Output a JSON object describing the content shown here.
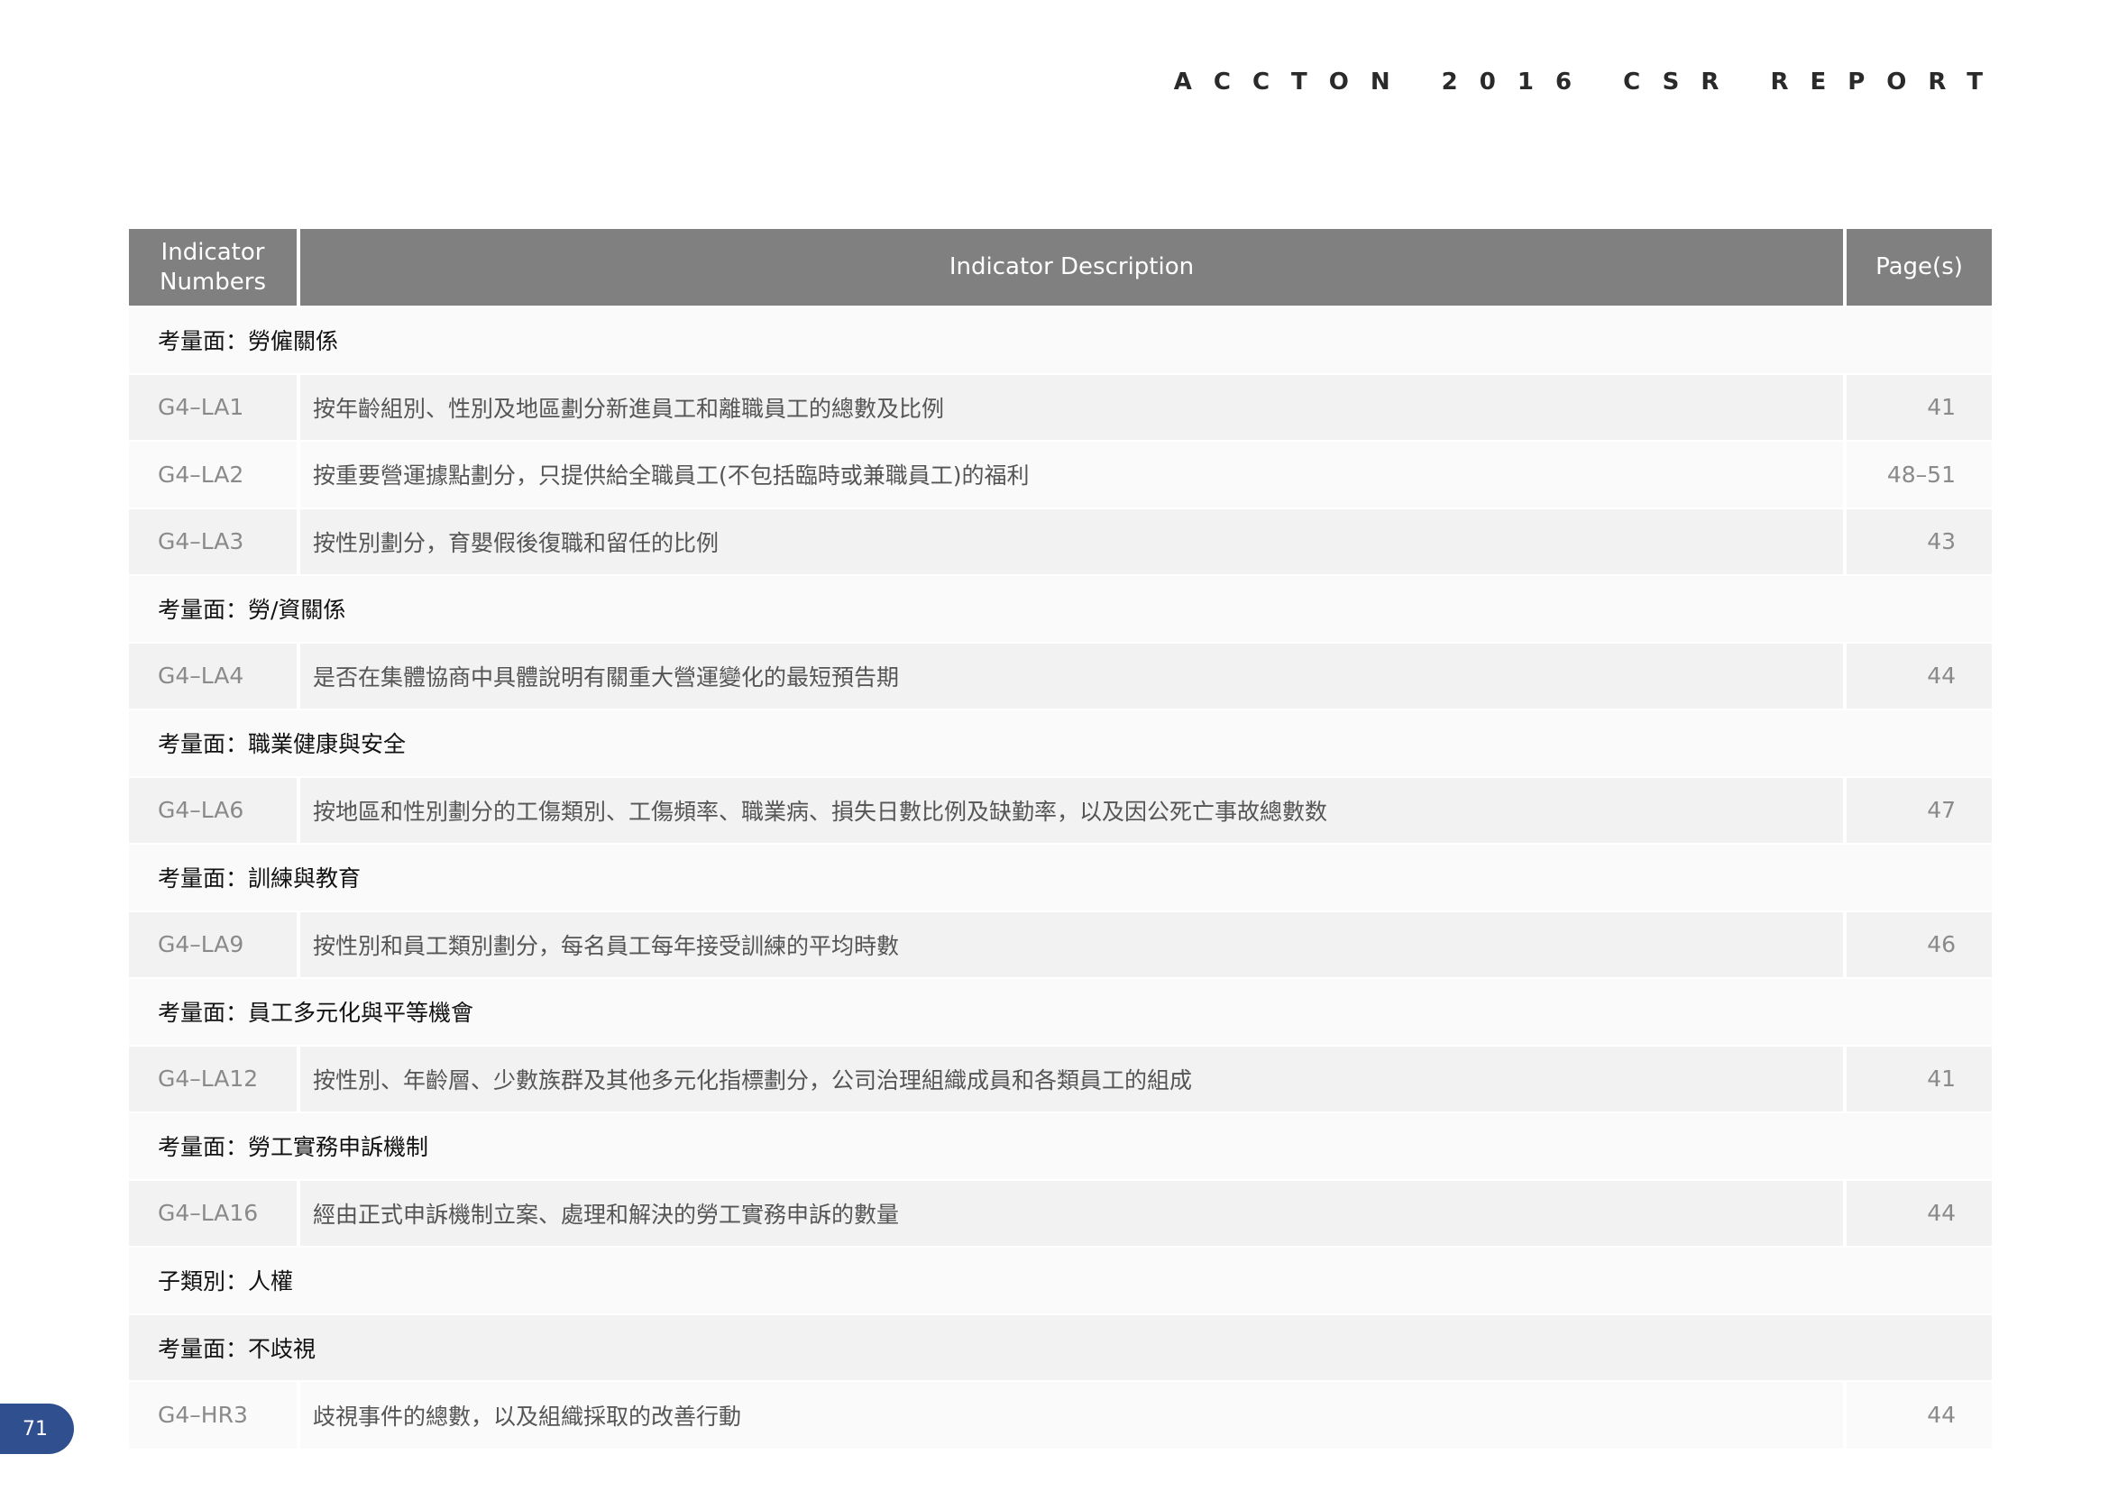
{
  "header": {
    "title": "ACCTON 2016 CSR REPORT"
  },
  "table": {
    "columns": {
      "number": "Indicator\nNumbers",
      "number_line1": "Indicator",
      "number_line2": "Numbers",
      "description": "Indicator Description",
      "pages": "Page(s)"
    },
    "rows": [
      {
        "type": "category",
        "label": "考量面：勞僱關係"
      },
      {
        "type": "data",
        "number": "G4–LA1",
        "description": "按年齡組別、性別及地區劃分新進員工和離職員工的總數及比例",
        "pages": "41"
      },
      {
        "type": "data",
        "number": "G4–LA2",
        "description": "按重要營運據點劃分，只提供給全職員工(不包括臨時或兼職員工)的福利",
        "pages": "48–51"
      },
      {
        "type": "data",
        "number": "G4–LA3",
        "description": "按性別劃分，育嬰假後復職和留任的比例",
        "pages": "43"
      },
      {
        "type": "category",
        "label": "考量面：勞/資關係"
      },
      {
        "type": "data",
        "number": "G4–LA4",
        "description": "是否在集體協商中具體說明有關重大營運變化的最短預告期",
        "pages": "44"
      },
      {
        "type": "category",
        "label": "考量面：職業健康與安全"
      },
      {
        "type": "data",
        "number": "G4–LA6",
        "description": "按地區和性別劃分的工傷類別、工傷頻率、職業病、損失日數比例及缺勤率，以及因公死亡事故總數数",
        "pages": "47"
      },
      {
        "type": "category",
        "label": "考量面：訓練與教育"
      },
      {
        "type": "data",
        "number": "G4–LA9",
        "description": "按性別和員工類別劃分，每名員工每年接受訓練的平均時數",
        "pages": "46"
      },
      {
        "type": "category",
        "label": "考量面：員工多元化與平等機會"
      },
      {
        "type": "data",
        "number": "G4–LA12",
        "description": "按性別、年齡層、少數族群及其他多元化指標劃分，公司治理組織成員和各類員工的組成",
        "pages": "41"
      },
      {
        "type": "category",
        "label": "考量面：勞工實務申訴機制"
      },
      {
        "type": "data",
        "number": "G4–LA16",
        "description": "經由正式申訴機制立案、處理和解決的勞工實務申訴的數量",
        "pages": "44"
      },
      {
        "type": "category",
        "label": "子類別：人權"
      },
      {
        "type": "category",
        "label": "考量面：不歧視"
      },
      {
        "type": "data",
        "number": "G4–HR3",
        "description": "歧視事件的總數，以及組織採取的改善行動",
        "pages": "44"
      }
    ]
  },
  "footer": {
    "page_number": "71"
  },
  "colors": {
    "header_bg": "#808080",
    "row_dark": "#f2f2f2",
    "row_light": "#fafafa",
    "page_tab": "#2f4f8f"
  }
}
